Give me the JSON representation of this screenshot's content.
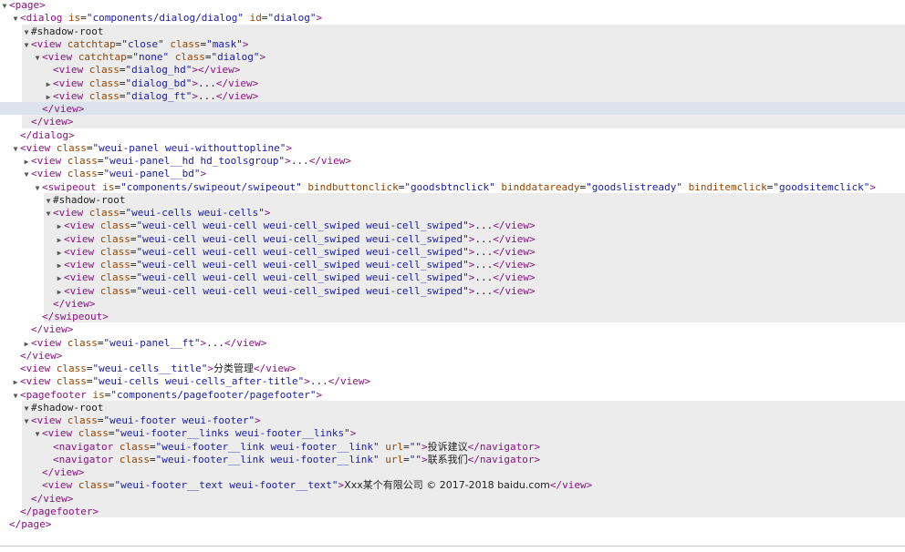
{
  "lines": [
    {
      "indent": 0,
      "arrow": "open",
      "parts": [
        {
          "t": "tag",
          "v": "<page>"
        }
      ]
    },
    {
      "indent": 1,
      "arrow": "open",
      "parts": [
        {
          "t": "tag",
          "v": "<dialog"
        },
        {
          "t": "attr",
          "v": " is"
        },
        {
          "t": "plain",
          "v": "="
        },
        {
          "t": "val",
          "v": "\"components/dialog/dialog\""
        },
        {
          "t": "attr",
          "v": " id"
        },
        {
          "t": "plain",
          "v": "="
        },
        {
          "t": "val",
          "v": "\"dialog\""
        },
        {
          "t": "tag",
          "v": ">"
        }
      ]
    },
    {
      "indent": 2,
      "arrow": "open",
      "parts": [
        {
          "t": "plain",
          "v": "#shadow-root"
        }
      ]
    },
    {
      "indent": 2,
      "arrow": "open",
      "parts": [
        {
          "t": "tag",
          "v": "<view"
        },
        {
          "t": "attr",
          "v": " catchtap"
        },
        {
          "t": "plain",
          "v": "="
        },
        {
          "t": "val",
          "v": "\"close\""
        },
        {
          "t": "attr",
          "v": " class"
        },
        {
          "t": "plain",
          "v": "="
        },
        {
          "t": "val",
          "v": "\"mask\""
        },
        {
          "t": "tag",
          "v": ">"
        }
      ]
    },
    {
      "indent": 3,
      "arrow": "open",
      "parts": [
        {
          "t": "tag",
          "v": "<view"
        },
        {
          "t": "attr",
          "v": " catchtap"
        },
        {
          "t": "plain",
          "v": "="
        },
        {
          "t": "val",
          "v": "\"none\""
        },
        {
          "t": "attr",
          "v": " class"
        },
        {
          "t": "plain",
          "v": "="
        },
        {
          "t": "val",
          "v": "\"dialog\""
        },
        {
          "t": "tag",
          "v": ">"
        }
      ]
    },
    {
      "indent": 4,
      "arrow": "none",
      "parts": [
        {
          "t": "tag",
          "v": "<view"
        },
        {
          "t": "attr",
          "v": " class"
        },
        {
          "t": "plain",
          "v": "="
        },
        {
          "t": "val",
          "v": "\"dialog_hd\""
        },
        {
          "t": "tag",
          "v": "></view>"
        }
      ]
    },
    {
      "indent": 4,
      "arrow": "closed",
      "parts": [
        {
          "t": "tag",
          "v": "<view"
        },
        {
          "t": "attr",
          "v": " class"
        },
        {
          "t": "plain",
          "v": "="
        },
        {
          "t": "val",
          "v": "\"dialog_bd\""
        },
        {
          "t": "tag",
          "v": ">"
        },
        {
          "t": "plain",
          "v": "..."
        },
        {
          "t": "tag",
          "v": "</view>"
        }
      ]
    },
    {
      "indent": 4,
      "arrow": "closed",
      "parts": [
        {
          "t": "tag",
          "v": "<view"
        },
        {
          "t": "attr",
          "v": " class"
        },
        {
          "t": "plain",
          "v": "="
        },
        {
          "t": "val",
          "v": "\"dialog_ft\""
        },
        {
          "t": "tag",
          "v": ">"
        },
        {
          "t": "plain",
          "v": "..."
        },
        {
          "t": "tag",
          "v": "</view>"
        }
      ]
    },
    {
      "indent": 3,
      "arrow": "none",
      "parts": [
        {
          "t": "tag",
          "v": "</view>"
        }
      ]
    },
    {
      "indent": 2,
      "arrow": "none",
      "parts": [
        {
          "t": "tag",
          "v": "</view>"
        }
      ]
    },
    {
      "indent": 1,
      "arrow": "none",
      "parts": [
        {
          "t": "tag",
          "v": "</dialog>"
        }
      ]
    },
    {
      "indent": 1,
      "arrow": "open",
      "parts": [
        {
          "t": "tag",
          "v": "<view"
        },
        {
          "t": "attr",
          "v": " class"
        },
        {
          "t": "plain",
          "v": "="
        },
        {
          "t": "val",
          "v": "\"weui-panel weui-withouttopline\""
        },
        {
          "t": "tag",
          "v": ">"
        }
      ]
    },
    {
      "indent": 2,
      "arrow": "closed",
      "parts": [
        {
          "t": "tag",
          "v": "<view"
        },
        {
          "t": "attr",
          "v": " class"
        },
        {
          "t": "plain",
          "v": "="
        },
        {
          "t": "val",
          "v": "\"weui-panel__hd hd_toolsgroup\""
        },
        {
          "t": "tag",
          "v": ">"
        },
        {
          "t": "plain",
          "v": "..."
        },
        {
          "t": "tag",
          "v": "</view>"
        }
      ]
    },
    {
      "indent": 2,
      "arrow": "open",
      "parts": [
        {
          "t": "tag",
          "v": "<view"
        },
        {
          "t": "attr",
          "v": " class"
        },
        {
          "t": "plain",
          "v": "="
        },
        {
          "t": "val",
          "v": "\"weui-panel__bd\""
        },
        {
          "t": "tag",
          "v": ">"
        }
      ]
    },
    {
      "indent": 3,
      "arrow": "open",
      "parts": [
        {
          "t": "tag",
          "v": "<swipeout"
        },
        {
          "t": "attr",
          "v": " is"
        },
        {
          "t": "plain",
          "v": "="
        },
        {
          "t": "val",
          "v": "\"components/swipeout/swipeout\""
        },
        {
          "t": "attr",
          "v": " bindbuttonclick"
        },
        {
          "t": "plain",
          "v": "="
        },
        {
          "t": "val",
          "v": "\"goodsbtnclick\""
        },
        {
          "t": "attr",
          "v": " binddataready"
        },
        {
          "t": "plain",
          "v": "="
        },
        {
          "t": "val",
          "v": "\"goodslistready\""
        },
        {
          "t": "attr",
          "v": " binditemclick"
        },
        {
          "t": "plain",
          "v": "="
        },
        {
          "t": "val",
          "v": "\"goodsitemclick\""
        },
        {
          "t": "tag",
          "v": ">"
        }
      ]
    },
    {
      "indent": 4,
      "arrow": "open",
      "parts": [
        {
          "t": "plain",
          "v": "#shadow-root"
        }
      ]
    },
    {
      "indent": 4,
      "arrow": "open",
      "parts": [
        {
          "t": "tag",
          "v": "<view"
        },
        {
          "t": "attr",
          "v": " class"
        },
        {
          "t": "plain",
          "v": "="
        },
        {
          "t": "val",
          "v": "\"weui-cells weui-cells\""
        },
        {
          "t": "tag",
          "v": ">"
        }
      ]
    },
    {
      "indent": 5,
      "arrow": "closed",
      "parts": [
        {
          "t": "tag",
          "v": "<view"
        },
        {
          "t": "attr",
          "v": " class"
        },
        {
          "t": "plain",
          "v": "="
        },
        {
          "t": "val",
          "v": "\"weui-cell weui-cell weui-cell_swiped weui-cell_swiped\""
        },
        {
          "t": "tag",
          "v": ">"
        },
        {
          "t": "plain",
          "v": "..."
        },
        {
          "t": "tag",
          "v": "</view>"
        }
      ]
    },
    {
      "indent": 5,
      "arrow": "closed",
      "parts": [
        {
          "t": "tag",
          "v": "<view"
        },
        {
          "t": "attr",
          "v": " class"
        },
        {
          "t": "plain",
          "v": "="
        },
        {
          "t": "val",
          "v": "\"weui-cell weui-cell weui-cell_swiped weui-cell_swiped\""
        },
        {
          "t": "tag",
          "v": ">"
        },
        {
          "t": "plain",
          "v": "..."
        },
        {
          "t": "tag",
          "v": "</view>"
        }
      ]
    },
    {
      "indent": 5,
      "arrow": "closed",
      "parts": [
        {
          "t": "tag",
          "v": "<view"
        },
        {
          "t": "attr",
          "v": " class"
        },
        {
          "t": "plain",
          "v": "="
        },
        {
          "t": "val",
          "v": "\"weui-cell weui-cell weui-cell_swiped weui-cell_swiped\""
        },
        {
          "t": "tag",
          "v": ">"
        },
        {
          "t": "plain",
          "v": "..."
        },
        {
          "t": "tag",
          "v": "</view>"
        }
      ]
    },
    {
      "indent": 5,
      "arrow": "closed",
      "parts": [
        {
          "t": "tag",
          "v": "<view"
        },
        {
          "t": "attr",
          "v": " class"
        },
        {
          "t": "plain",
          "v": "="
        },
        {
          "t": "val",
          "v": "\"weui-cell weui-cell weui-cell_swiped weui-cell_swiped\""
        },
        {
          "t": "tag",
          "v": ">"
        },
        {
          "t": "plain",
          "v": "..."
        },
        {
          "t": "tag",
          "v": "</view>"
        }
      ]
    },
    {
      "indent": 5,
      "arrow": "closed",
      "parts": [
        {
          "t": "tag",
          "v": "<view"
        },
        {
          "t": "attr",
          "v": " class"
        },
        {
          "t": "plain",
          "v": "="
        },
        {
          "t": "val",
          "v": "\"weui-cell weui-cell weui-cell_swiped weui-cell_swiped\""
        },
        {
          "t": "tag",
          "v": ">"
        },
        {
          "t": "plain",
          "v": "..."
        },
        {
          "t": "tag",
          "v": "</view>"
        }
      ]
    },
    {
      "indent": 5,
      "arrow": "closed",
      "parts": [
        {
          "t": "tag",
          "v": "<view"
        },
        {
          "t": "attr",
          "v": " class"
        },
        {
          "t": "plain",
          "v": "="
        },
        {
          "t": "val",
          "v": "\"weui-cell weui-cell weui-cell_swiped weui-cell_swiped\""
        },
        {
          "t": "tag",
          "v": ">"
        },
        {
          "t": "plain",
          "v": "..."
        },
        {
          "t": "tag",
          "v": "</view>"
        }
      ]
    },
    {
      "indent": 4,
      "arrow": "none",
      "parts": [
        {
          "t": "tag",
          "v": "</view>"
        }
      ]
    },
    {
      "indent": 3,
      "arrow": "none",
      "parts": [
        {
          "t": "tag",
          "v": "</swipeout>"
        }
      ]
    },
    {
      "indent": 2,
      "arrow": "none",
      "parts": [
        {
          "t": "tag",
          "v": "</view>"
        }
      ]
    },
    {
      "indent": 2,
      "arrow": "closed",
      "parts": [
        {
          "t": "tag",
          "v": "<view"
        },
        {
          "t": "attr",
          "v": " class"
        },
        {
          "t": "plain",
          "v": "="
        },
        {
          "t": "val",
          "v": "\"weui-panel__ft\""
        },
        {
          "t": "tag",
          "v": ">"
        },
        {
          "t": "plain",
          "v": "..."
        },
        {
          "t": "tag",
          "v": "</view>"
        }
      ]
    },
    {
      "indent": 1,
      "arrow": "none",
      "parts": [
        {
          "t": "tag",
          "v": "</view>"
        }
      ]
    },
    {
      "indent": 1,
      "arrow": "none",
      "parts": [
        {
          "t": "tag",
          "v": "<view"
        },
        {
          "t": "attr",
          "v": " class"
        },
        {
          "t": "plain",
          "v": "="
        },
        {
          "t": "val",
          "v": "\"weui-cells__title\""
        },
        {
          "t": "tag",
          "v": ">"
        },
        {
          "t": "txt",
          "v": "分类管理"
        },
        {
          "t": "tag",
          "v": "</view>"
        }
      ]
    },
    {
      "indent": 1,
      "arrow": "closed",
      "parts": [
        {
          "t": "tag",
          "v": "<view"
        },
        {
          "t": "attr",
          "v": " class"
        },
        {
          "t": "plain",
          "v": "="
        },
        {
          "t": "val",
          "v": "\"weui-cells weui-cells_after-title\""
        },
        {
          "t": "tag",
          "v": ">"
        },
        {
          "t": "plain",
          "v": "..."
        },
        {
          "t": "tag",
          "v": "</view>"
        }
      ]
    },
    {
      "indent": 1,
      "arrow": "open",
      "parts": [
        {
          "t": "tag",
          "v": "<pagefooter"
        },
        {
          "t": "attr",
          "v": " is"
        },
        {
          "t": "plain",
          "v": "="
        },
        {
          "t": "val",
          "v": "\"components/pagefooter/pagefooter\""
        },
        {
          "t": "tag",
          "v": ">"
        }
      ]
    },
    {
      "indent": 2,
      "arrow": "open",
      "parts": [
        {
          "t": "plain",
          "v": "#shadow-root"
        }
      ]
    },
    {
      "indent": 2,
      "arrow": "open",
      "parts": [
        {
          "t": "tag",
          "v": "<view"
        },
        {
          "t": "attr",
          "v": " class"
        },
        {
          "t": "plain",
          "v": "="
        },
        {
          "t": "val",
          "v": "\"weui-footer weui-footer\""
        },
        {
          "t": "tag",
          "v": ">"
        }
      ]
    },
    {
      "indent": 3,
      "arrow": "open",
      "parts": [
        {
          "t": "tag",
          "v": "<view"
        },
        {
          "t": "attr",
          "v": " class"
        },
        {
          "t": "plain",
          "v": "="
        },
        {
          "t": "val",
          "v": "\"weui-footer__links weui-footer__links\""
        },
        {
          "t": "tag",
          "v": ">"
        }
      ]
    },
    {
      "indent": 4,
      "arrow": "none",
      "parts": [
        {
          "t": "tag",
          "v": "<navigator"
        },
        {
          "t": "attr",
          "v": " class"
        },
        {
          "t": "plain",
          "v": "="
        },
        {
          "t": "val",
          "v": "\"weui-footer__link weui-footer__link\""
        },
        {
          "t": "attr",
          "v": " url"
        },
        {
          "t": "plain",
          "v": "="
        },
        {
          "t": "val",
          "v": "\"\""
        },
        {
          "t": "tag",
          "v": ">"
        },
        {
          "t": "txt",
          "v": "投诉建议"
        },
        {
          "t": "tag",
          "v": "</navigator>"
        }
      ]
    },
    {
      "indent": 4,
      "arrow": "none",
      "parts": [
        {
          "t": "tag",
          "v": "<navigator"
        },
        {
          "t": "attr",
          "v": " class"
        },
        {
          "t": "plain",
          "v": "="
        },
        {
          "t": "val",
          "v": "\"weui-footer__link weui-footer__link\""
        },
        {
          "t": "attr",
          "v": " url"
        },
        {
          "t": "plain",
          "v": "="
        },
        {
          "t": "val",
          "v": "\"\""
        },
        {
          "t": "tag",
          "v": ">"
        },
        {
          "t": "txt",
          "v": "联系我们"
        },
        {
          "t": "tag",
          "v": "</navigator>"
        }
      ]
    },
    {
      "indent": 3,
      "arrow": "none",
      "parts": [
        {
          "t": "tag",
          "v": "</view>"
        }
      ]
    },
    {
      "indent": 3,
      "arrow": "none",
      "parts": [
        {
          "t": "tag",
          "v": "<view"
        },
        {
          "t": "attr",
          "v": " class"
        },
        {
          "t": "plain",
          "v": "="
        },
        {
          "t": "val",
          "v": "\"weui-footer__text weui-footer__text\""
        },
        {
          "t": "tag",
          "v": ">"
        },
        {
          "t": "txt",
          "v": "Xxx某个有限公司 © 2017-2018 baidu.com"
        },
        {
          "t": "tag",
          "v": "</view>"
        }
      ]
    },
    {
      "indent": 2,
      "arrow": "none",
      "parts": [
        {
          "t": "tag",
          "v": "</view>"
        }
      ]
    },
    {
      "indent": 1,
      "arrow": "none",
      "parts": [
        {
          "t": "tag",
          "v": "</pagefooter>"
        }
      ]
    },
    {
      "indent": 0,
      "arrow": "none",
      "parts": [
        {
          "t": "tag",
          "v": "</page>"
        }
      ]
    }
  ]
}
